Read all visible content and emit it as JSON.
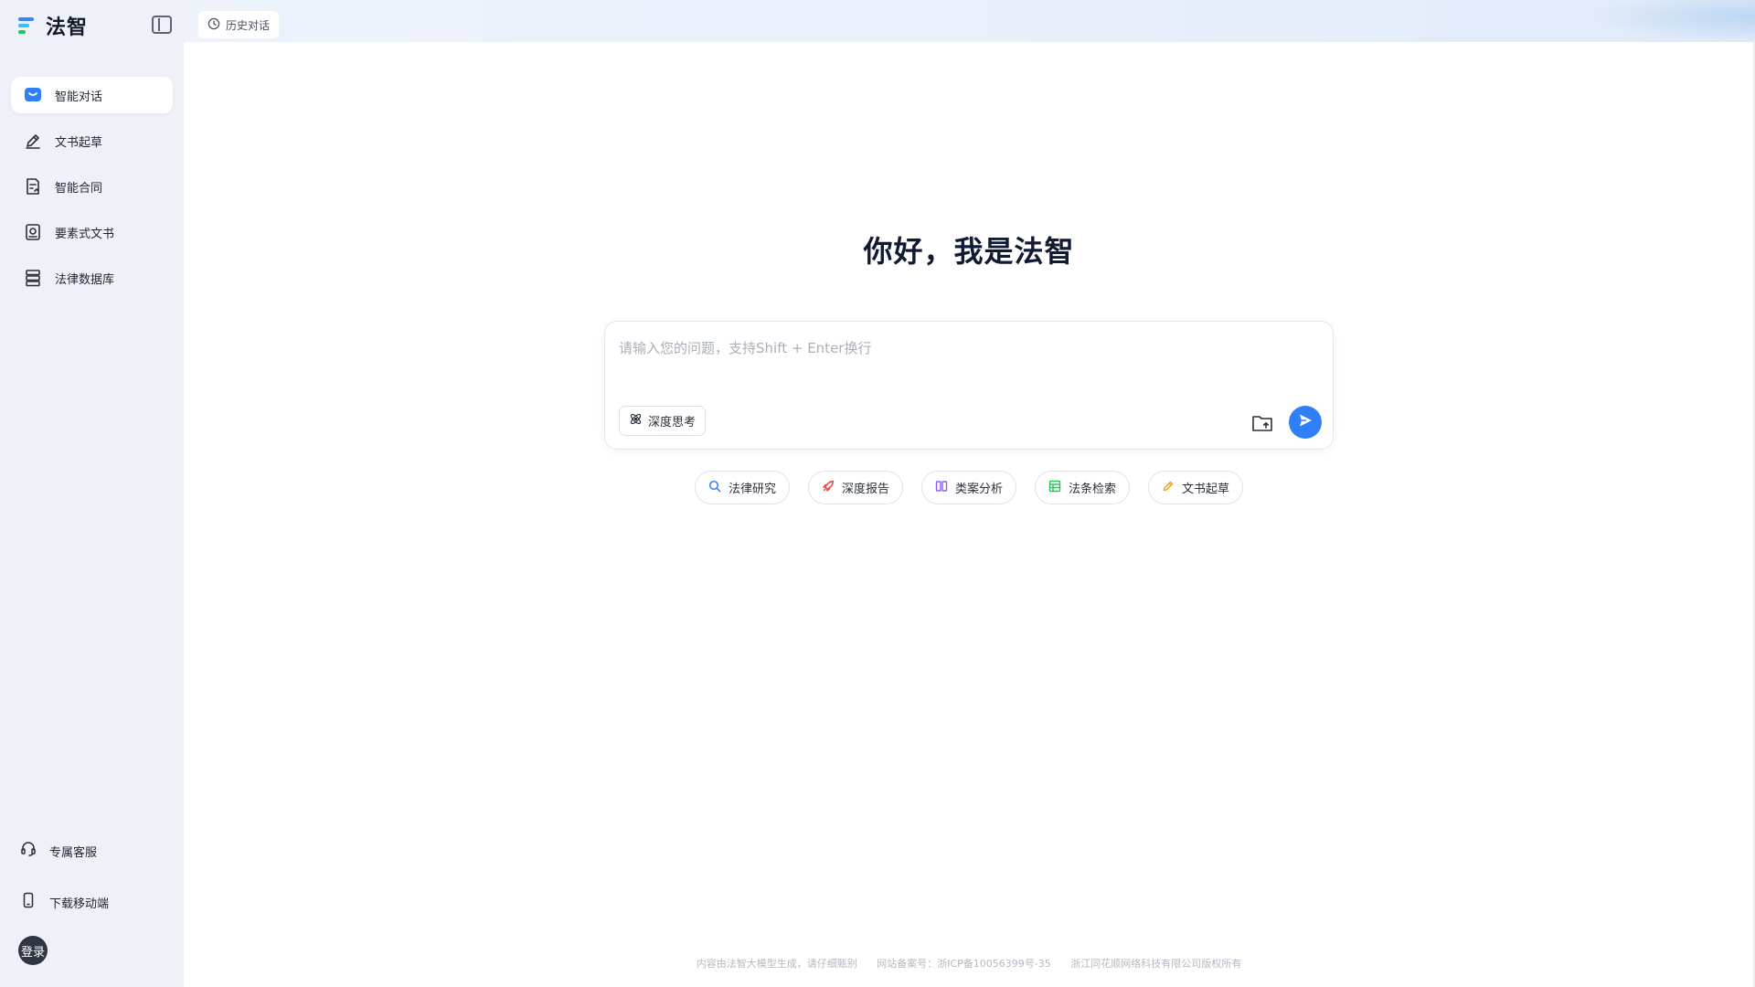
{
  "brand": {
    "name": "法智"
  },
  "topbar": {
    "history_label": "历史对话"
  },
  "sidebar": {
    "items": [
      {
        "label": "智能对话",
        "icon": "chat-icon",
        "active": true
      },
      {
        "label": "文书起草",
        "icon": "pen-icon",
        "active": false
      },
      {
        "label": "智能合同",
        "icon": "contract-icon",
        "active": false
      },
      {
        "label": "要素式文书",
        "icon": "element-doc-icon",
        "active": false
      },
      {
        "label": "法律数据库",
        "icon": "database-icon",
        "active": false
      }
    ],
    "bottom": [
      {
        "label": "专属客服",
        "icon": "headset-icon"
      },
      {
        "label": "下载移动端",
        "icon": "phone-icon"
      }
    ],
    "login_label": "登录"
  },
  "main": {
    "greeting": "你好，我是法智",
    "input_placeholder": "请输入您的问题，支持Shift + Enter换行",
    "deep_think_label": "深度思考",
    "chips": [
      {
        "label": "法律研究",
        "icon": "search-icon",
        "color": "#2f7ff6"
      },
      {
        "label": "深度报告",
        "icon": "rocket-icon",
        "color": "#ef4444"
      },
      {
        "label": "类案分析",
        "icon": "compare-icon",
        "color": "#8b5cf6"
      },
      {
        "label": "法条检索",
        "icon": "table-icon",
        "color": "#22c55e"
      },
      {
        "label": "文书起草",
        "icon": "pen-icon",
        "color": "#f59e0b"
      }
    ]
  },
  "footer": {
    "disclaimer": "内容由法智大模型生成，请仔细甄别",
    "icp": "网站备案号：浙ICP备10056399号-35",
    "copyright": "浙江同花顺网络科技有限公司版权所有"
  },
  "colors": {
    "accent": "#2f7ff6",
    "sidebar_bg": "#eef1f8",
    "login_bg": "#2f3542"
  }
}
